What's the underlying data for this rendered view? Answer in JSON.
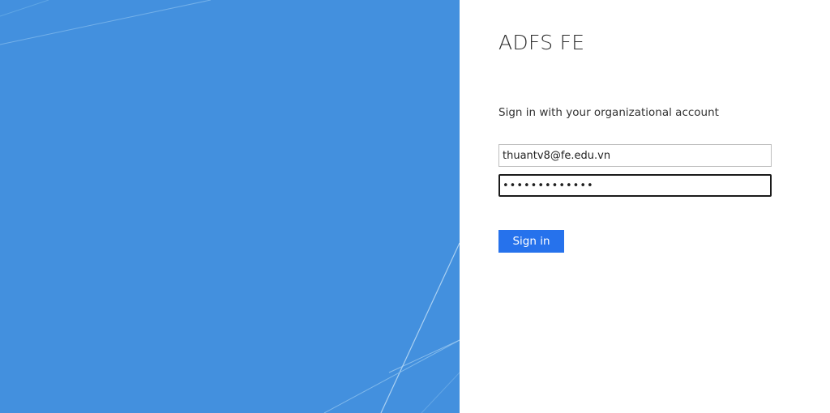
{
  "brand": {
    "title": "ADFS FE",
    "accent_color": "#4390de",
    "button_color": "#2672ec"
  },
  "form": {
    "heading": "Sign in with your organizational account",
    "username_value": "thuantv8@fe.edu.vn",
    "password_value": "•••••••••••••",
    "signin_label": "Sign in"
  }
}
